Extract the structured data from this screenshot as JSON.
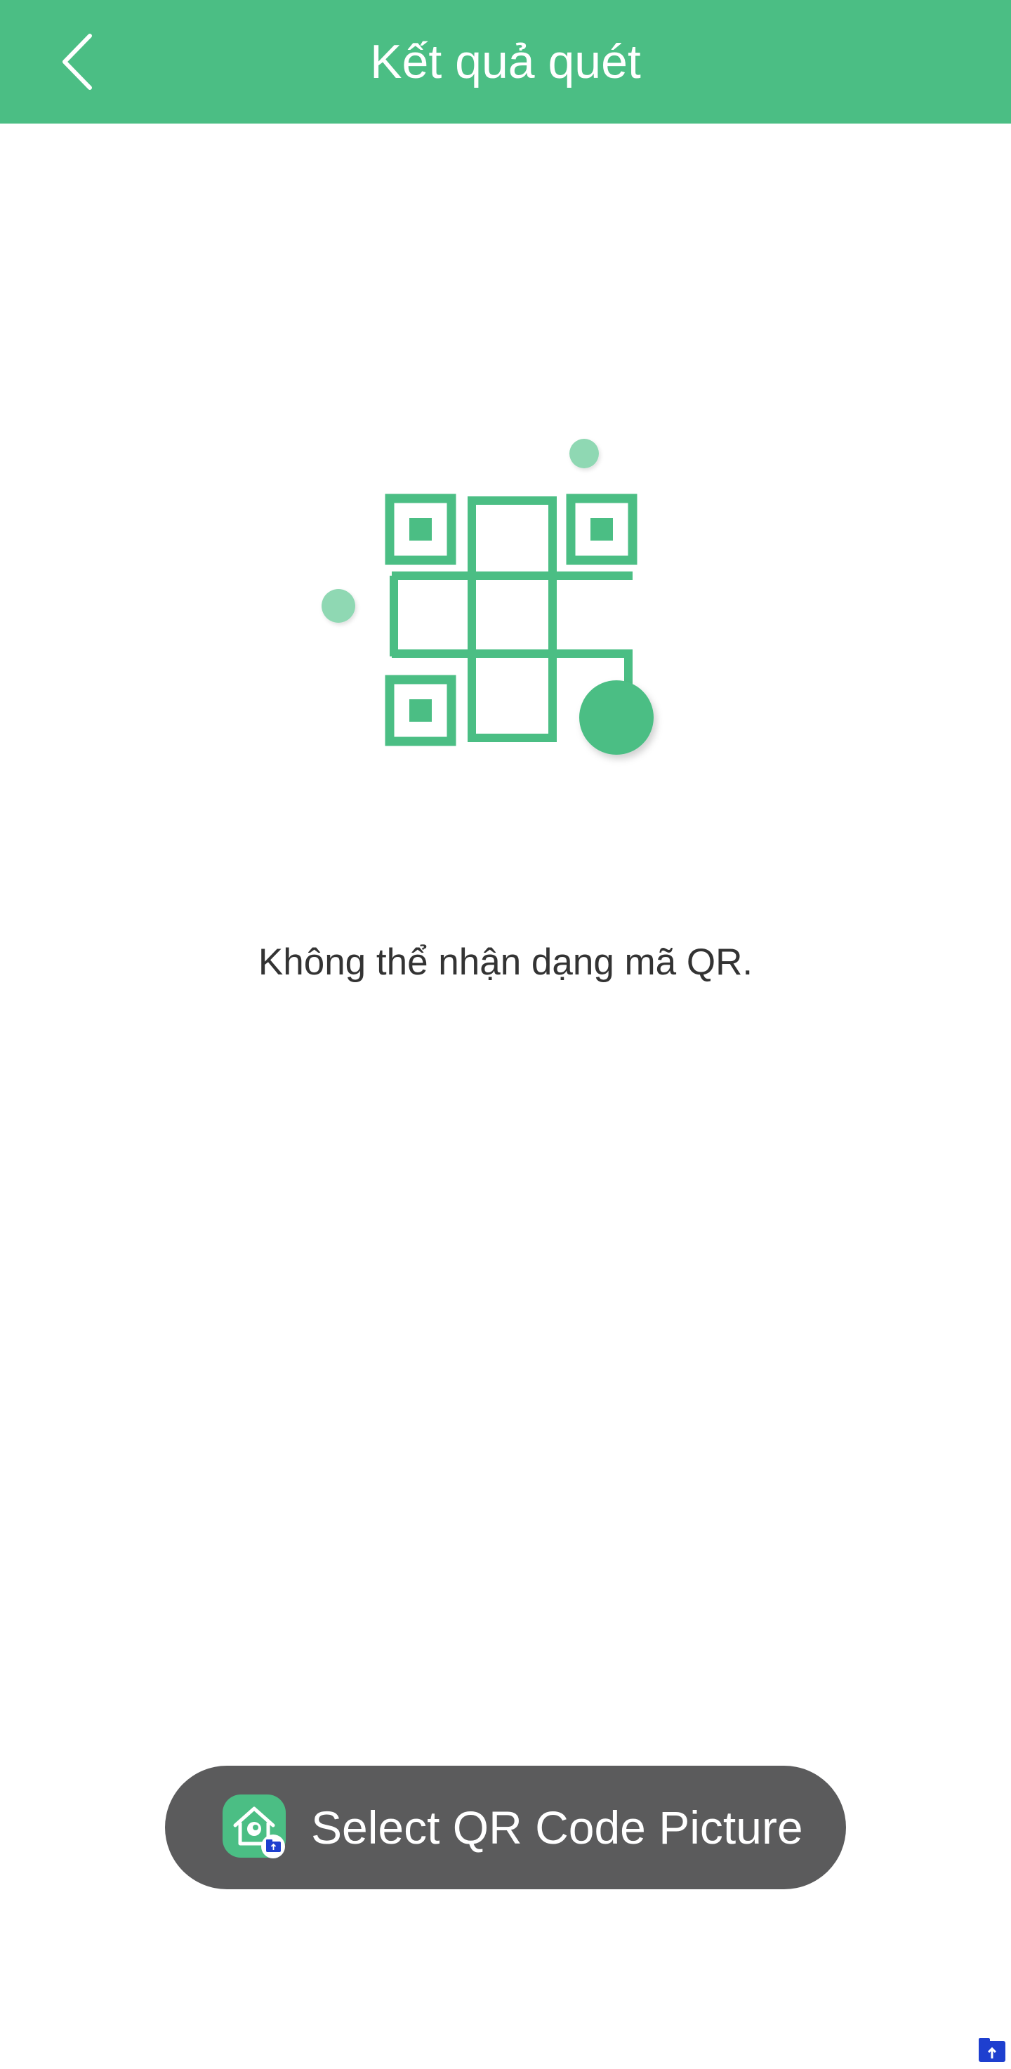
{
  "header": {
    "title": "Kết quả quét",
    "back_icon": "chevron-left-icon"
  },
  "illustration": {
    "icon": "qr-code-icon",
    "accent_color": "#4bbe84",
    "light_accent_color": "#8fd8b3"
  },
  "message": "Không thể nhận dạng mã QR.",
  "select_button": {
    "label": "Select QR Code Picture",
    "icon": "home-camera-app-icon",
    "badge_icon": "folder-upload-icon"
  },
  "colors": {
    "header_bg": "#4bbe84",
    "button_bg": "#5b5b5c",
    "text": "#333333",
    "badge_blue": "#1e3fcf"
  }
}
